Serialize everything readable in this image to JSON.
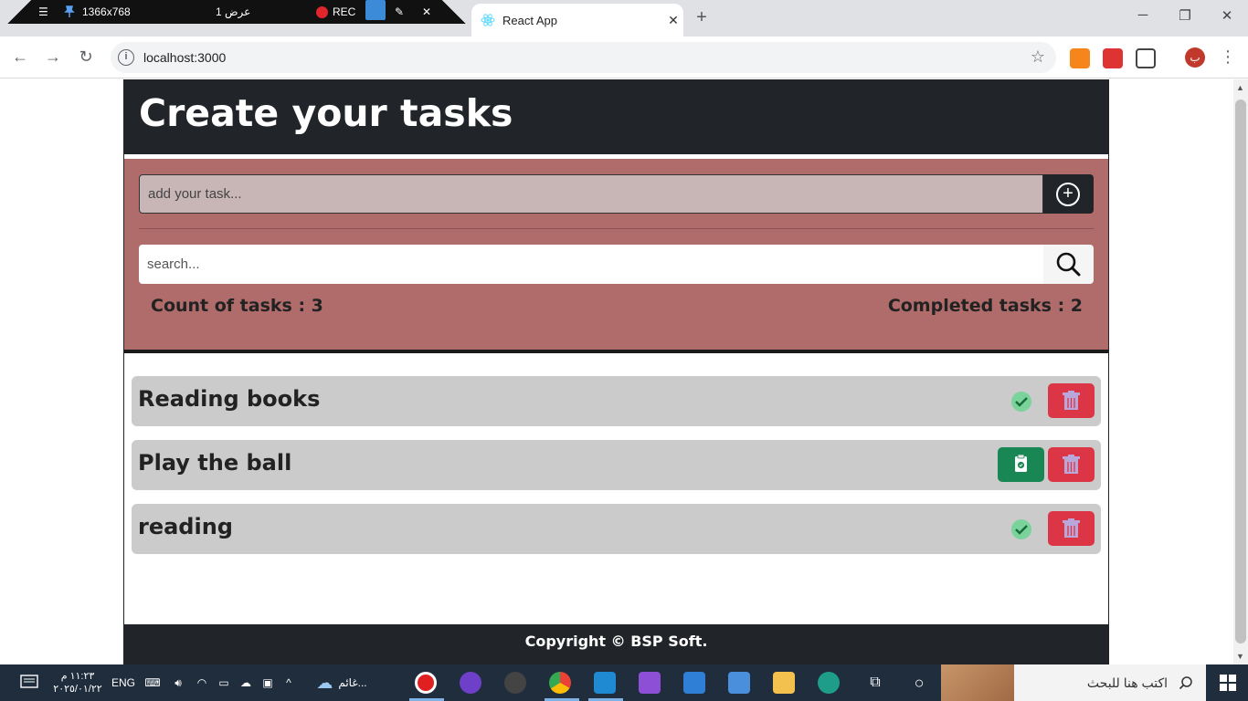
{
  "recorder": {
    "resolution": "1366x768",
    "view_label": "عرض 1",
    "rec_label": "REC"
  },
  "browser": {
    "tab_title": "React App",
    "url": "localhost:3000",
    "profile_initial": "ب"
  },
  "app": {
    "title": "Create your tasks",
    "add_placeholder": "add your task...",
    "search_placeholder": "search...",
    "count_label": "Count of tasks : 3",
    "completed_label": "Completed tasks : 2",
    "tasks": [
      {
        "name": "Reading books",
        "completed": true
      },
      {
        "name": "Play the ball",
        "completed": false
      },
      {
        "name": "reading",
        "completed": true
      }
    ],
    "footer": "Copyright © BSP Soft."
  },
  "taskbar": {
    "search_text": "اكتب هنا للبحث",
    "weather": "غائم...",
    "lang": "ENG",
    "time": "١١:٢٣ م",
    "date": "٢٠٢٥/٠١/٢٢"
  },
  "colors": {
    "header": "#212529",
    "panel": "#b06b6b",
    "task_bg": "#cbcbcb",
    "delete": "#dc3545",
    "complete": "#198754"
  }
}
